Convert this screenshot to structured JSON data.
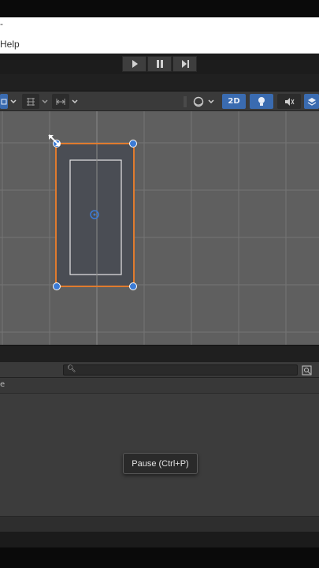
{
  "window": {
    "title_fragment": "-"
  },
  "menu": {
    "help_label": "Help"
  },
  "playbar": {
    "play_label": "Play",
    "pause_label": "Pause",
    "step_label": "Step"
  },
  "scene_toolbar": {
    "mode_2d_label": "2D"
  },
  "project": {
    "search_placeholder": "",
    "breadcrumb_fragment": "e"
  },
  "tooltip": {
    "text": "Pause (Ctrl+P)"
  },
  "colors": {
    "selection_outline": "#e07b2e",
    "handle_blue": "#3b7bd6",
    "accent_blue": "#3a6bb0",
    "viewport_bg": "#5f5f5f"
  }
}
